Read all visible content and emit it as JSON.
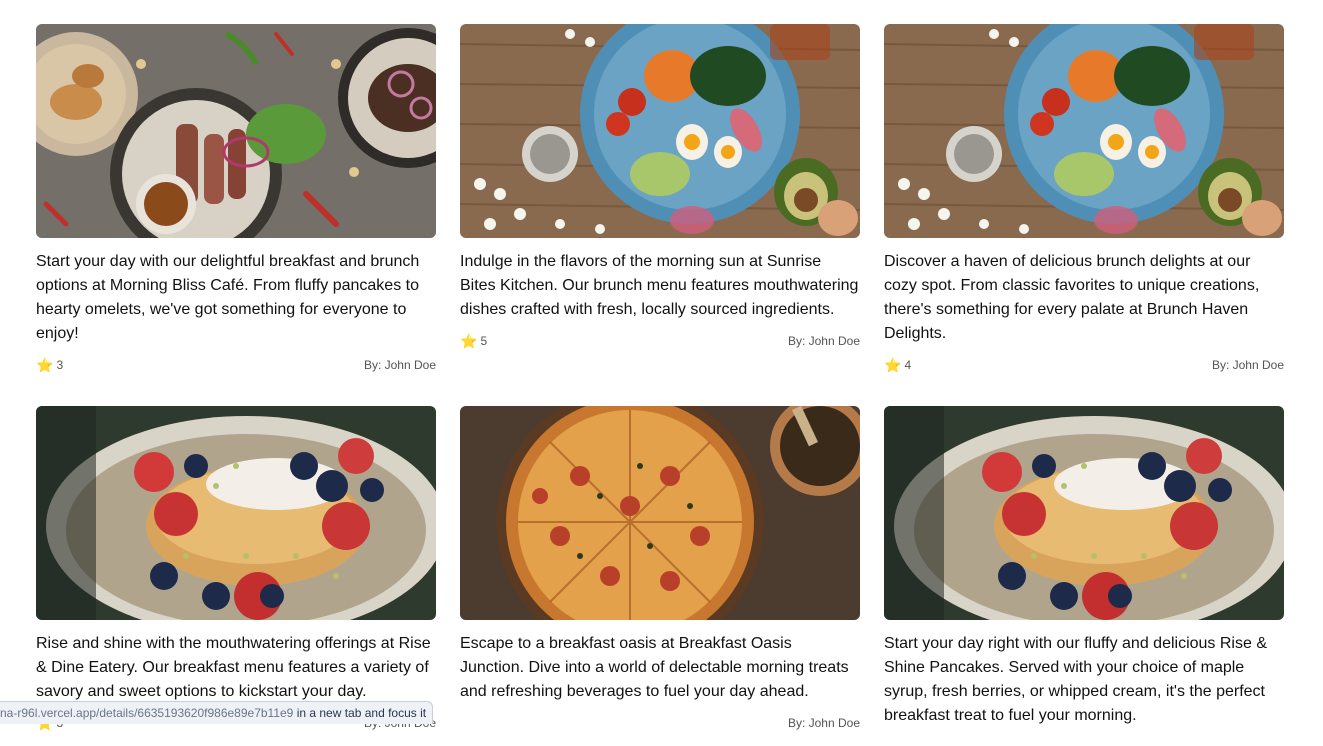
{
  "cards": [
    {
      "description": "Start your day with our delightful breakfast and brunch options at Morning Bliss Café. From fluffy pancakes to hearty omelets, we've got something for everyone to enjoy!",
      "rating": "3",
      "author": "By: John Doe",
      "image": "grilled-steak-salad-bowls"
    },
    {
      "description": "Indulge in the flavors of the morning sun at Sunrise Bites Kitchen. Our brunch menu features mouthwatering dishes crafted with fresh, locally sourced ingredients.",
      "rating": "5",
      "author": "By: John Doe",
      "image": "egg-avocado-plate-on-wood"
    },
    {
      "description": "Discover a haven of delicious brunch delights at our cozy spot. From classic favorites to unique creations, there's something for every palate at Brunch Haven Delights.",
      "rating": "4",
      "author": "By: John Doe",
      "image": "egg-avocado-plate-on-wood"
    },
    {
      "description": "Rise and shine with the mouthwatering offerings at Rise & Dine Eatery. Our breakfast menu features a variety of savory and sweet options to kickstart your day.",
      "rating": "3",
      "author": "By: John Doe",
      "image": "pancakes-with-berries"
    },
    {
      "description": "Escape to a breakfast oasis at Breakfast Oasis Junction. Dive into a world of delectable morning treats and refreshing beverages to fuel your day ahead.",
      "rating": "",
      "author": "By: John Doe",
      "image": "pizza-on-board"
    },
    {
      "description": "Start your day right with our fluffy and delicious Rise & Shine Pancakes. Served with your choice of maple syrup, fresh berries, or whipped cream, it's the perfect breakfast treat to fuel your morning.",
      "rating": "",
      "author": "",
      "image": "pancakes-with-berries"
    }
  ],
  "status_bar": {
    "url": "na-r96l.vercel.app/details/6635193620f986e89e7b11e9",
    "action": " in a new tab and focus it"
  },
  "colors": {
    "star": "#f5b301",
    "text": "#111111",
    "meta": "#555555"
  }
}
